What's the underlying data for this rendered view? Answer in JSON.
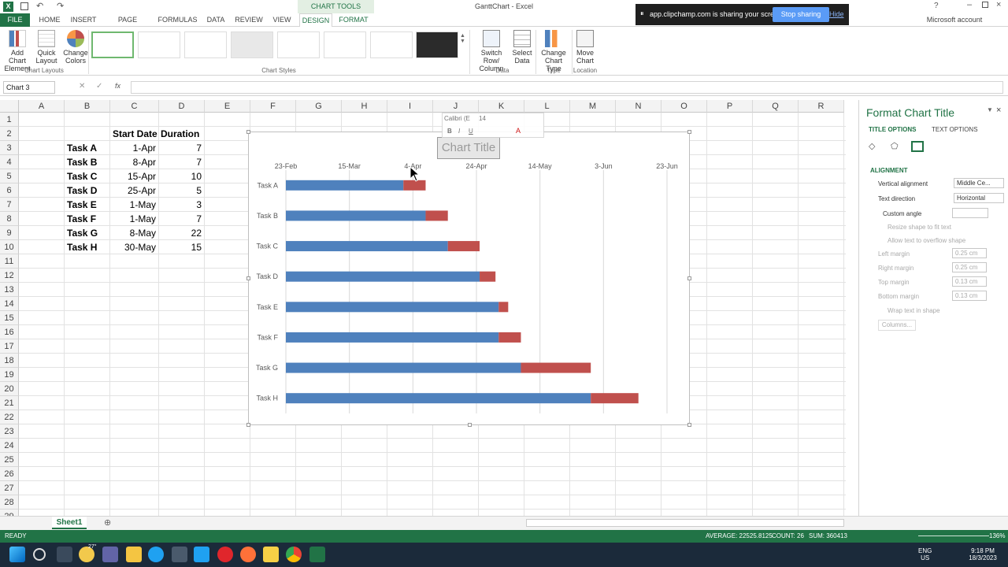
{
  "window": {
    "title": "GanttChart - Excel",
    "context_tab_header": "CHART TOOLS",
    "account": "Microsoft account"
  },
  "tabs": [
    {
      "label": "FILE"
    },
    {
      "label": "HOME"
    },
    {
      "label": "INSERT"
    },
    {
      "label": "PAGE LAYOUT"
    },
    {
      "label": "FORMULAS"
    },
    {
      "label": "DATA"
    },
    {
      "label": "REVIEW"
    },
    {
      "label": "VIEW"
    },
    {
      "label": "DESIGN"
    },
    {
      "label": "FORMAT"
    }
  ],
  "ribbon": {
    "add_chart_element": "Add Chart Element",
    "quick_layout": "Quick Layout",
    "change_colors": "Change Colors",
    "switch_row_column": "Switch Row/ Column",
    "select_data": "Select Data",
    "change_chart_type": "Change Chart Type",
    "move_chart": "Move Chart",
    "groups": {
      "chart_layouts": "Chart Layouts",
      "chart_styles": "Chart Styles",
      "data": "Data",
      "type": "Type",
      "location": "Location"
    }
  },
  "share_notice": {
    "text": "app.clipchamp.com is sharing your screen.",
    "stop_label": "Stop sharing",
    "hide_label": "Hide"
  },
  "formula_bar": {
    "name_box": "Chart 3",
    "fx": "fx",
    "content": ""
  },
  "columns": [
    "A",
    "B",
    "C",
    "D",
    "E",
    "F",
    "G",
    "H",
    "I",
    "J",
    "K",
    "L",
    "M",
    "N",
    "O",
    "P",
    "Q",
    "R"
  ],
  "rows": [
    "1",
    "2",
    "3",
    "4",
    "5",
    "6",
    "7",
    "8",
    "9",
    "10",
    "11",
    "12",
    "13",
    "14",
    "15",
    "16",
    "17",
    "18",
    "19",
    "20",
    "21",
    "22",
    "23",
    "24",
    "25",
    "26",
    "27",
    "28",
    "29"
  ],
  "table": {
    "header_start": "Start Date",
    "header_duration": "Duration",
    "rows": [
      {
        "task": "Task A",
        "start": "1-Apr",
        "duration": "7"
      },
      {
        "task": "Task B",
        "start": "8-Apr",
        "duration": "7"
      },
      {
        "task": "Task C",
        "start": "15-Apr",
        "duration": "10"
      },
      {
        "task": "Task D",
        "start": "25-Apr",
        "duration": "5"
      },
      {
        "task": "Task E",
        "start": "1-May",
        "duration": "3"
      },
      {
        "task": "Task F",
        "start": "1-May",
        "duration": "7"
      },
      {
        "task": "Task G",
        "start": "8-May",
        "duration": "22"
      },
      {
        "task": "Task H",
        "start": "30-May",
        "duration": "15"
      }
    ]
  },
  "mini_toolbar": {
    "font": "Calibri (E",
    "size": "14"
  },
  "chart_data": {
    "type": "bar",
    "orientation": "horizontal",
    "stacked": true,
    "title": "Chart Title",
    "categories": [
      "Task A",
      "Task B",
      "Task C",
      "Task D",
      "Task E",
      "Task F",
      "Task G",
      "Task H"
    ],
    "x_tick_labels": [
      "23-Feb",
      "15-Mar",
      "4-Apr",
      "24-Apr",
      "14-May",
      "3-Jun",
      "23-Jun"
    ],
    "x_axis_position": "top",
    "grid": true,
    "xlim_days_from_23_feb": [
      0,
      120
    ],
    "series": [
      {
        "values": [
          37,
          44,
          51,
          61,
          67,
          67,
          74,
          96
        ],
        "color": "#4f81bd",
        "note_start_offsets": true
      },
      {
        "values": [
          7,
          7,
          10,
          5,
          3,
          7,
          22,
          15
        ],
        "color": "#c0504d"
      }
    ]
  },
  "format_pane": {
    "title": "Format Chart Title",
    "tab_title_options": "TITLE OPTIONS",
    "tab_text_options": "TEXT OPTIONS",
    "section": "ALIGNMENT",
    "vertical_alignment_label": "Vertical alignment",
    "vertical_alignment_value": "Middle Ce...",
    "text_direction_label": "Text direction",
    "text_direction_value": "Horizontal",
    "custom_angle_label": "Custom angle",
    "resize_shape": "Resize shape to fit text",
    "allow_overflow": "Allow text to overflow shape",
    "left_margin_label": "Left margin",
    "left_margin_value": "0.25 cm",
    "right_margin_label": "Right margin",
    "right_margin_value": "0.25 cm",
    "top_margin_label": "Top margin",
    "top_margin_value": "0.13 cm",
    "bottom_margin_label": "Bottom margin",
    "bottom_margin_value": "0.13 cm",
    "wrap_text": "Wrap text in shape",
    "columns_button": "Columns..."
  },
  "sheet_tab": "Sheet1",
  "status": {
    "mode": "READY",
    "average": "AVERAGE: 22525.8125",
    "count": "COUNT: 26",
    "sum": "SUM: 360413",
    "zoom": "136%"
  },
  "taskbar": {
    "temp": "27°",
    "lang": "ENG",
    "region": "US",
    "time": "9:18 PM",
    "date": "18/3/2023"
  },
  "colors": {
    "excel_green": "#217346",
    "bar_blue": "#4f81bd",
    "bar_red": "#c0504d"
  }
}
